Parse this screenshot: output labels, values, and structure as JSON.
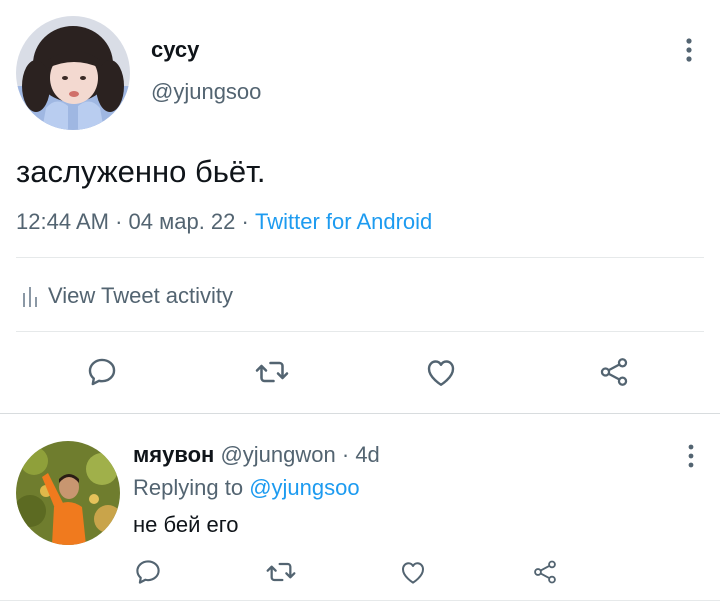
{
  "tweet": {
    "display_name": "сусу",
    "handle": "@yjungsoo",
    "text": "заслуженно бьёт.",
    "time": "12:44 AM",
    "date": "04 мар. 22",
    "separator": "·",
    "source": "Twitter for Android",
    "activity_label": "View Tweet activity",
    "avatar_icon": "user-avatar-girl",
    "actions": [
      "reply-icon",
      "retweet-icon",
      "like-icon",
      "share-icon"
    ]
  },
  "reply": {
    "display_name": "мяувон",
    "handle": "@yjungwon",
    "age": "4d",
    "separator": "·",
    "replying_prefix": "Replying to",
    "replying_mention": "@yjungsoo",
    "text": "не бей его",
    "avatar_icon": "user-avatar-orange",
    "actions": [
      "reply-icon",
      "retweet-icon",
      "like-icon",
      "share-icon"
    ]
  },
  "colors": {
    "accent": "#1d9bf0",
    "text_primary": "#0f1419",
    "text_secondary": "#536471",
    "icon": "#536471",
    "divider": "#e6e9ea"
  }
}
